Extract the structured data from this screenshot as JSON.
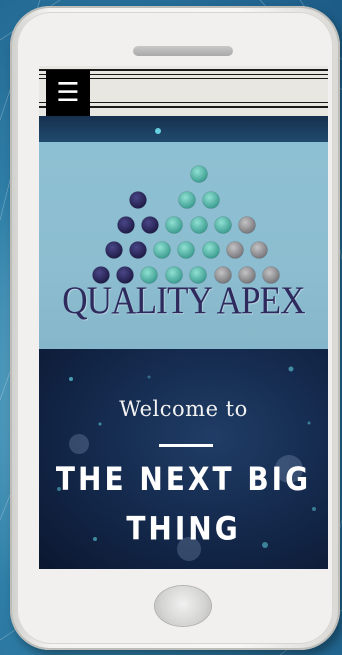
{
  "site": {
    "menu_icon": "hamburger-menu-icon",
    "menu_glyph": "☰",
    "logo_text": "QUALITY APEX",
    "hero": {
      "welcome": "Welcome to",
      "headline": "THE NEXT BIG THING"
    }
  },
  "colors": {
    "logo_background": "#8ec0d3",
    "logo_text": "#2e2a5e",
    "dot_dark": "#2d2a5d",
    "dot_teal": "#4fb3a5",
    "dot_gray": "#8e8e91",
    "hero_background": "#152b4f",
    "menu_button": "#000000"
  }
}
